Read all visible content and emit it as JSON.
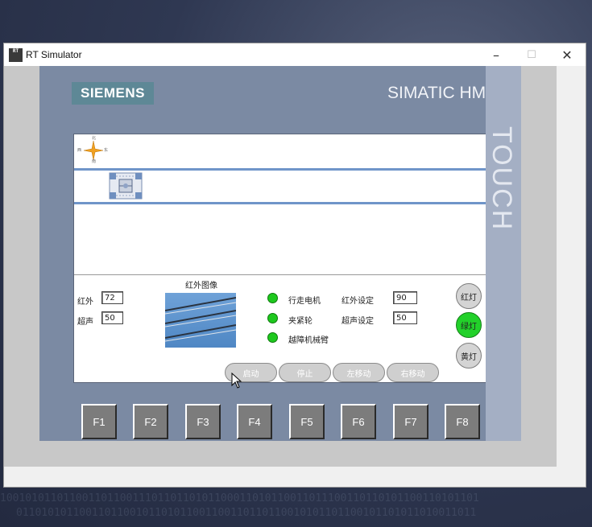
{
  "window": {
    "icon_text": "RT",
    "title": "RT Simulator",
    "controls": {
      "minimize": "–",
      "maximize": "☐",
      "close": "✕"
    }
  },
  "device": {
    "brand": "SIEMENS",
    "model": "SIMATIC HMI",
    "side_label": "TOUCH"
  },
  "screen": {
    "compass": {
      "north": "北",
      "south": "南",
      "east": "东",
      "west": "西"
    },
    "sensors": {
      "infrared_label": "红外",
      "infrared_value": "72",
      "ultrasonic_label": "超声",
      "ultrasonic_value": "50"
    },
    "ir_image_title": "红外图像",
    "status_indicators": [
      {
        "label": "行走电机",
        "color": "#1ec81e"
      },
      {
        "label": "夹紧轮",
        "color": "#1ec81e"
      },
      {
        "label": "越障机械臂",
        "color": "#1ec81e"
      }
    ],
    "settings": {
      "infrared_set_label": "红外设定",
      "infrared_set_value": "90",
      "ultrasonic_set_label": "超声设定",
      "ultrasonic_set_value": "50"
    },
    "lights": {
      "red": "红灯",
      "green": "绿灯",
      "yellow": "黄灯",
      "active": "green"
    },
    "action_buttons": {
      "start": "启动",
      "stop": "停止",
      "move_left": "左移动",
      "move_right": "右移动"
    }
  },
  "function_keys": [
    "F1",
    "F2",
    "F3",
    "F4",
    "F5",
    "F6",
    "F7",
    "F8"
  ],
  "colors": {
    "led_on": "#1ec81e",
    "green_light_active": "#22d12a",
    "rail": "#6f95c9",
    "siemens_badge": "#5e8896"
  }
}
